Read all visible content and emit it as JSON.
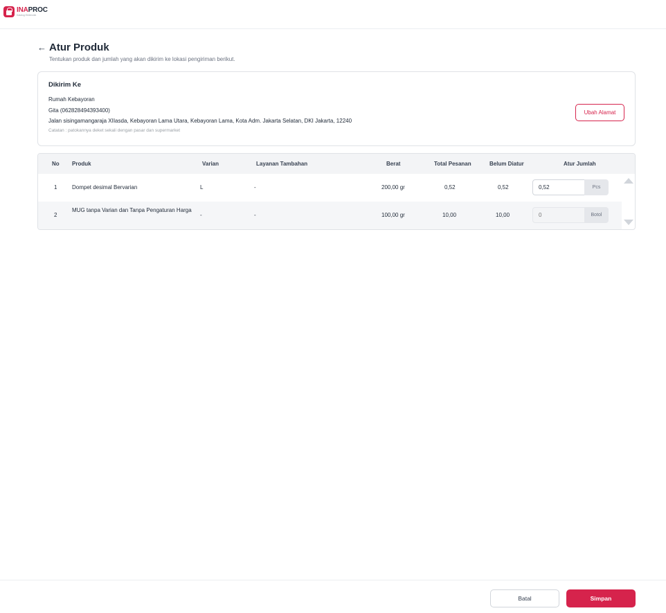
{
  "app": {
    "logo_word_a": "INA",
    "logo_word_b": "PROC",
    "logo_sub": "Katalog Elektronik",
    "brand_color": "#d6234c"
  },
  "page": {
    "back_icon": "arrow-left-icon",
    "title": "Atur Produk",
    "subtitle": "Tentukan produk dan jumlah yang akan dikirim ke lokasi pengiriman berikut."
  },
  "address": {
    "heading": "Dikirim Ke",
    "name": "Rumah Kebayoran",
    "recipient": "Gita (062828494393400)",
    "street": "Jalan sisingamangaraja XIIasda, Kebayoran Lama Utara, Kebayoran Lama, Kota Adm. Jakarta Selatan, DKI Jakarta, 12240",
    "note": "Catatan : patokannya deket sekali dengan pasar dan supermarket",
    "change_button": "Ubah Alamat"
  },
  "table": {
    "headers": {
      "no": "No",
      "product": "Produk",
      "variant": "Varian",
      "service": "Layanan Tambahan",
      "weight": "Berat",
      "total": "Total Pesanan",
      "pending": "Belum Diatur",
      "qty": "Atur Jumlah"
    },
    "rows": [
      {
        "no": "1",
        "product": "Dompet desimal Bervarian",
        "variant": "L",
        "service": "-",
        "weight": "200,00 gr",
        "total": "0,52",
        "pending": "0,52",
        "qty_value": "0,52",
        "unit": "Pcs",
        "disabled": false
      },
      {
        "no": "2",
        "product": "MUG tanpa Varian dan Tanpa Pengaturan Harga",
        "variant": "-",
        "service": "-",
        "weight": "100,00 gr",
        "total": "10,00",
        "pending": "10,00",
        "qty_value": "",
        "qty_placeholder": "0",
        "unit": "Botol",
        "disabled": true
      }
    ]
  },
  "footer": {
    "cancel": "Batal",
    "save": "Simpan"
  }
}
